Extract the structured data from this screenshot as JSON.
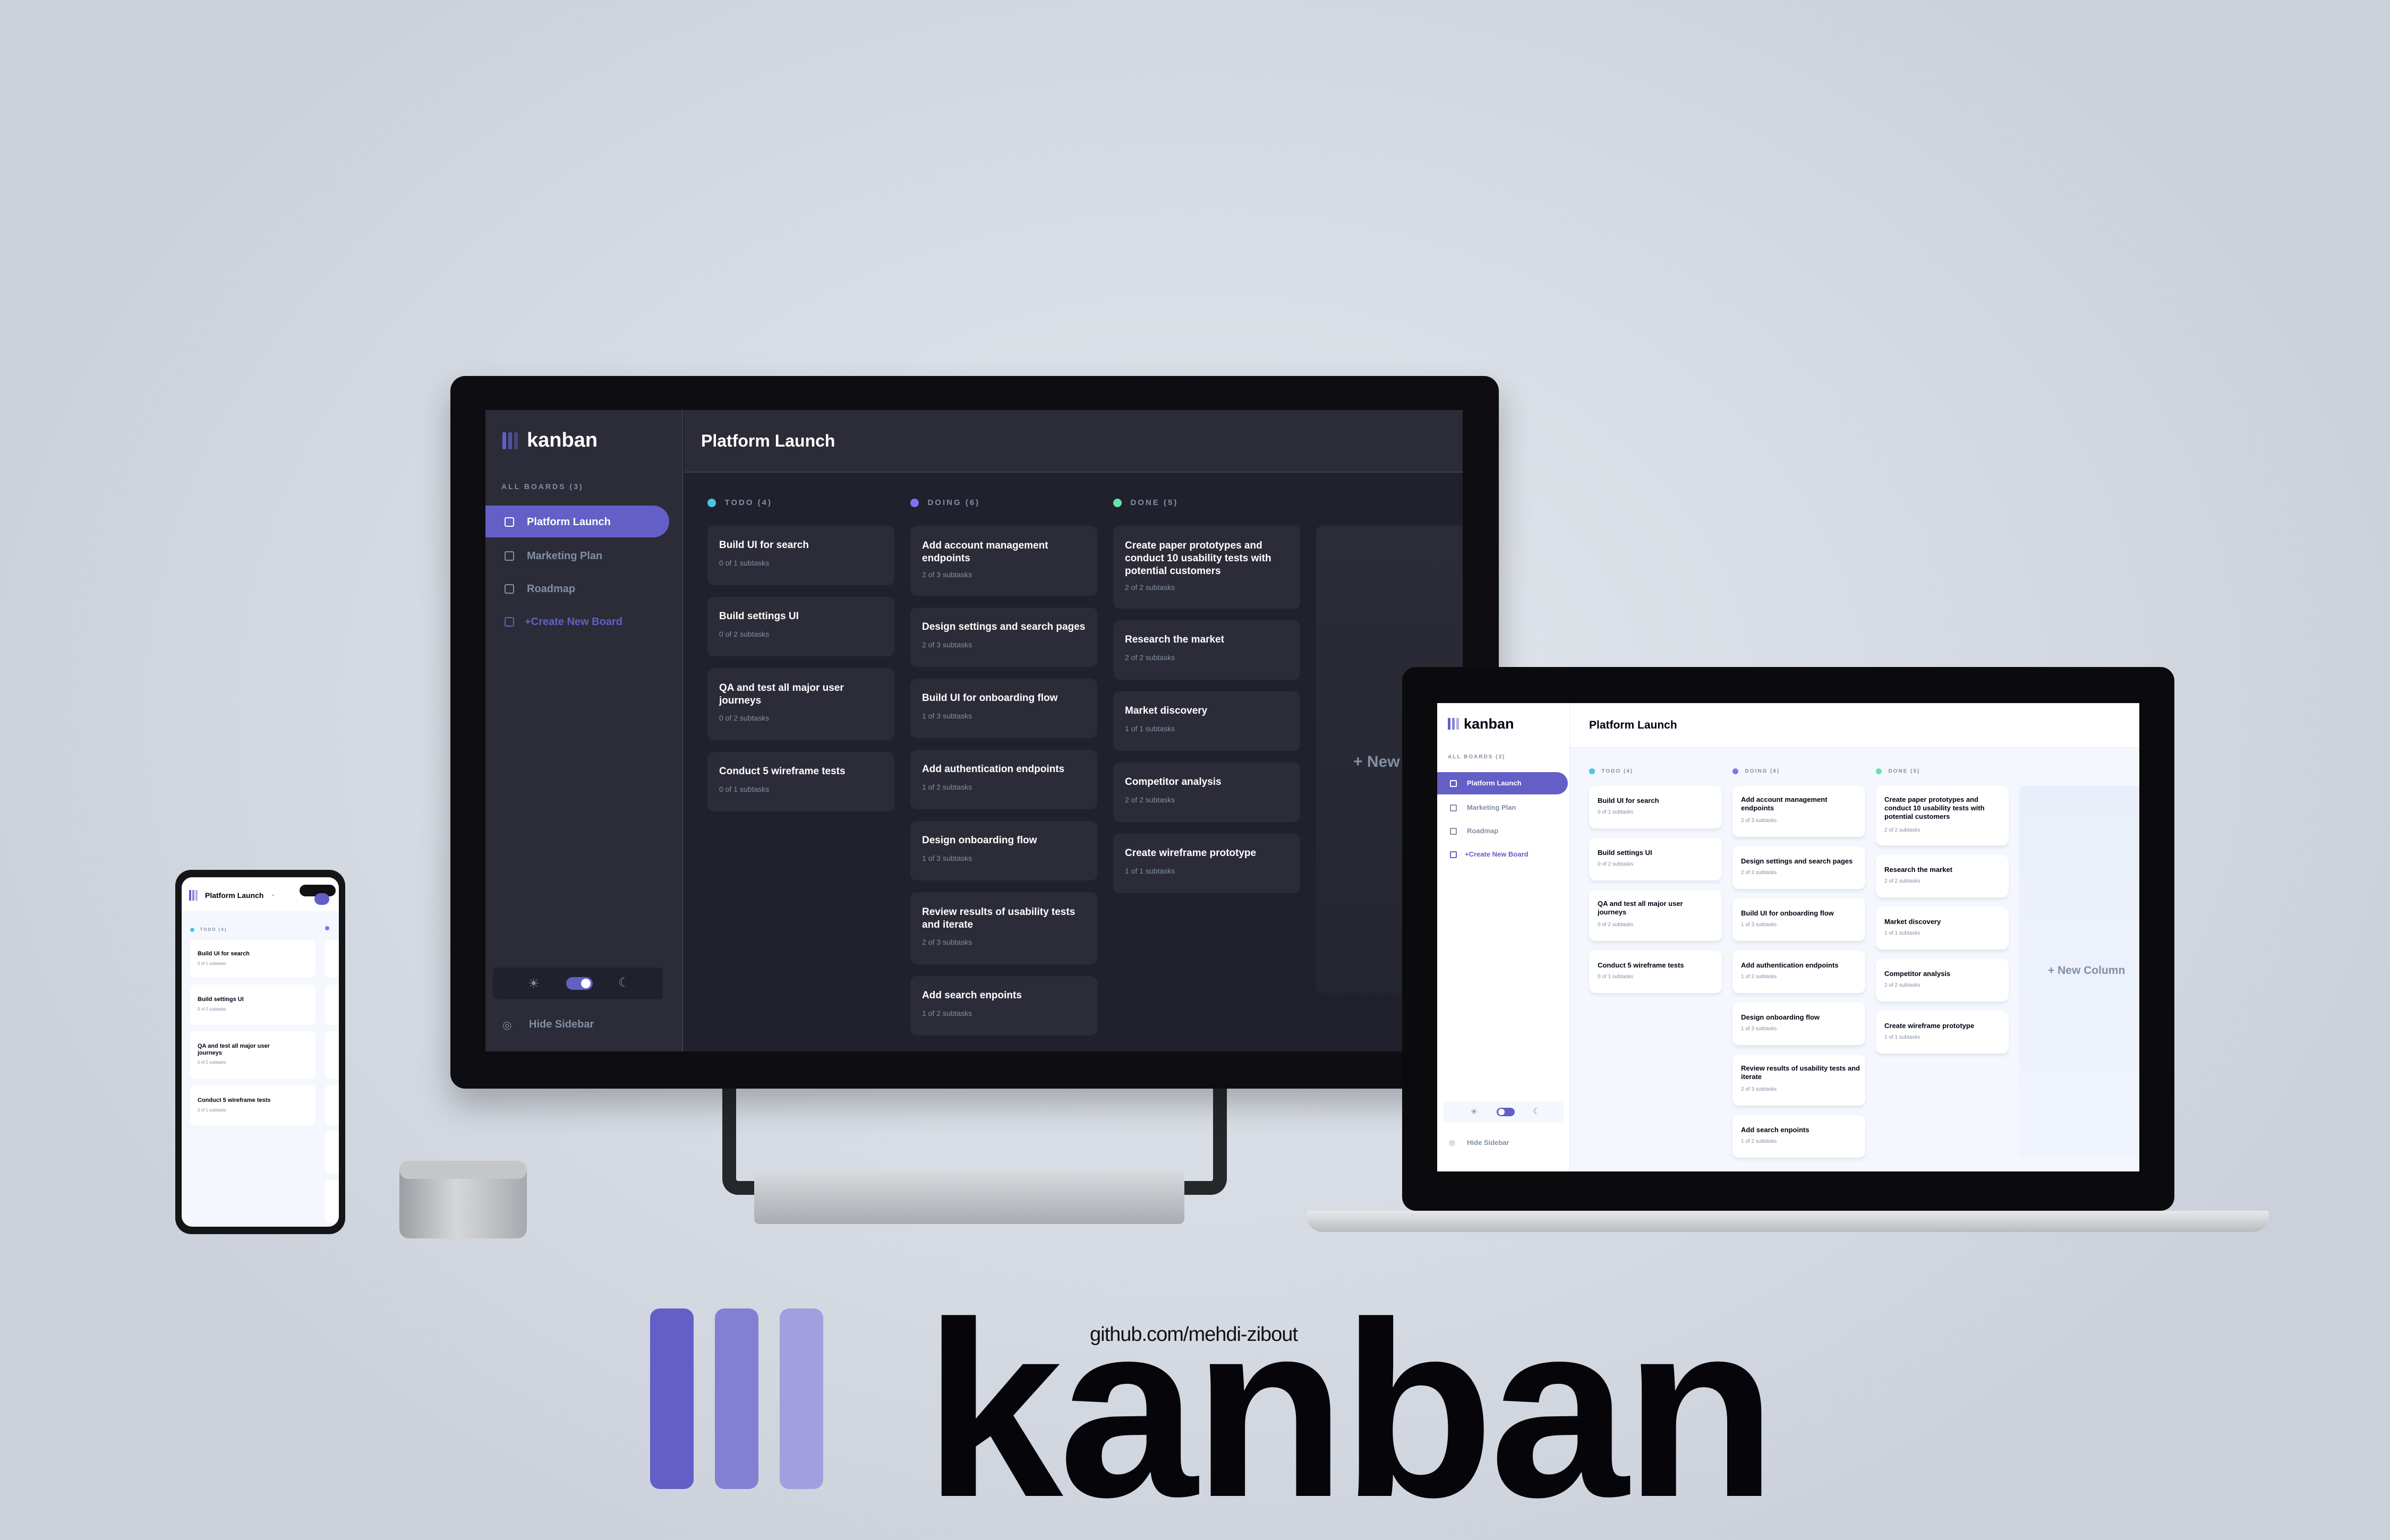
{
  "app": {
    "logo_text": "kanban",
    "board_title": "Platform Launch",
    "all_boards_label": "ALL BOARDS (3)",
    "boards": [
      "Platform Launch",
      "Marketing Plan",
      "Roadmap"
    ],
    "create_board_label": "+Create New Board",
    "hide_sidebar_label": "Hide Sidebar",
    "new_column_label": "+ New Column",
    "new_column_truncated": "+ New",
    "theme_icons": {
      "light": "sun-icon",
      "dark": "moon-icon"
    }
  },
  "columns": [
    {
      "name": "TODO (4)",
      "color": "#49c4e5",
      "tasks": [
        {
          "title": "Build UI for search",
          "subtasks": "0 of 1 subtasks"
        },
        {
          "title": "Build settings UI",
          "subtasks": "0 of 2 subtasks"
        },
        {
          "title": "QA and test all major user journeys",
          "subtasks": "0 of 2 subtasks"
        },
        {
          "title": "Conduct 5 wireframe tests",
          "subtasks": "0 of 1 subtasks"
        }
      ]
    },
    {
      "name": "DOING (6)",
      "color": "#8471f2",
      "tasks": [
        {
          "title": "Add account management endpoints",
          "subtasks": "2 of 3 subtasks"
        },
        {
          "title": "Design settings and search pages",
          "subtasks": "2 of 3 subtasks"
        },
        {
          "title": "Build UI for onboarding flow",
          "subtasks": "1 of 3 subtasks"
        },
        {
          "title": "Add authentication endpoints",
          "subtasks": "1 of 2 subtasks"
        },
        {
          "title": "Design onboarding flow",
          "subtasks": "1 of 3 subtasks"
        },
        {
          "title": "Review results of usability tests and iterate",
          "subtasks": "2 of 3 subtasks"
        },
        {
          "title": "Add search enpoints",
          "subtasks": "1 of 2 subtasks"
        }
      ]
    },
    {
      "name": "DONE (5)",
      "color": "#67e2ae",
      "tasks": [
        {
          "title": "Create paper prototypes and conduct 10 usability tests with potential customers",
          "subtasks": "2 of 2 subtasks"
        },
        {
          "title": "Research the market",
          "subtasks": "2 of 2 subtasks"
        },
        {
          "title": "Market discovery",
          "subtasks": "1 of 1 subtasks"
        },
        {
          "title": "Competitor analysis",
          "subtasks": "2 of 2 subtasks"
        },
        {
          "title": "Create wireframe prototype",
          "subtasks": "1 of 1 subtasks"
        }
      ]
    }
  ],
  "branding": {
    "wordmark": "kanban",
    "github": "github.com/mehdi-zibout",
    "bar_colors": [
      "#635fc7",
      "#8380d4",
      "#a19fdd"
    ]
  },
  "colors": {
    "accent": "#635fc7",
    "dark_bg": "#20212c",
    "dark_panel": "#2b2c37",
    "light_bg": "#f4f7fd",
    "light_panel": "#ffffff"
  }
}
